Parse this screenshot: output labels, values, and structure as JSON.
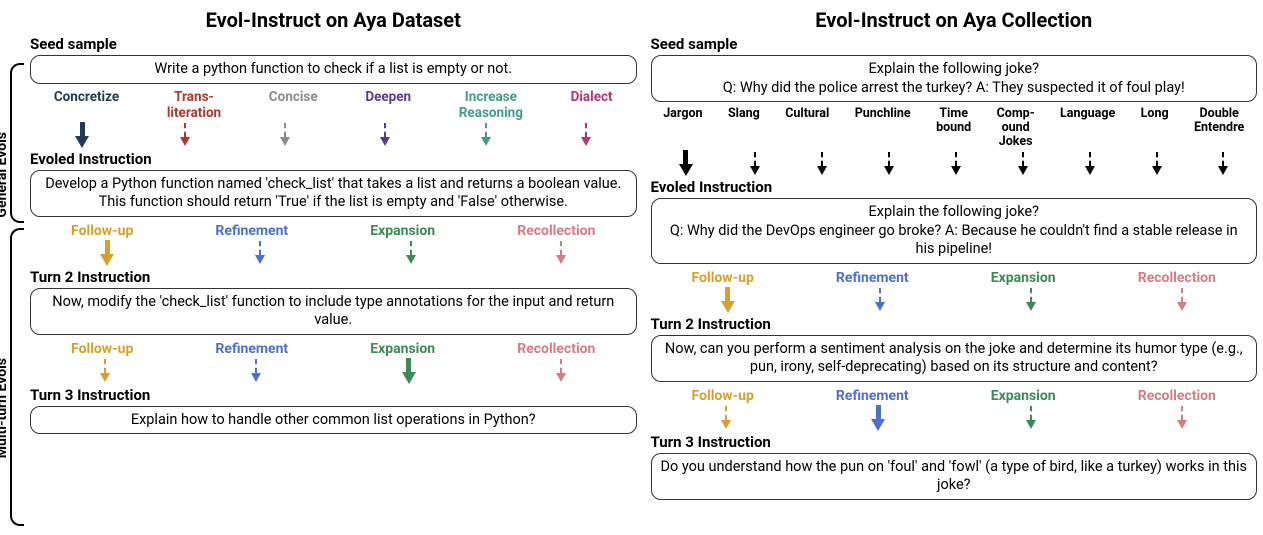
{
  "left": {
    "title": "Evol-Instruct on Aya Dataset",
    "seed_head": "Seed sample",
    "seed_text": "Write a  python function to check if a list is empty or not.",
    "gen_tags": {
      "concretize": "Concretize",
      "translit": "Trans-\nliteration",
      "concise": "Concise",
      "deepen": "Deepen",
      "reason": "Increase\nReasoning",
      "dialect": "Dialect"
    },
    "evoled_head": "Evoled Instruction",
    "evoled_text": "Develop a Python function named 'check_list' that takes a list and returns a boolean value. This function should return 'True' if the list is empty and 'False' otherwise.",
    "mt": {
      "followup": "Follow-up",
      "refine": "Refinement",
      "expand": "Expansion",
      "recoll": "Recollection"
    },
    "turn2_head": "Turn 2 Instruction",
    "turn2_text": "Now, modify the 'check_list' function to include type annotations for the input and return value.",
    "turn3_head": "Turn 3 Instruction",
    "turn3_text": "Explain how to handle other common list operations in Python?"
  },
  "right": {
    "title": "Evol-Instruct on Aya Collection",
    "seed_head": "Seed sample",
    "seed_text_l1": "Explain the following joke?",
    "seed_text_l2": "Q: Why did the police arrest the turkey? A: They suspected it of foul play!",
    "gen_tags": {
      "jargon": "Jargon",
      "slang": "Slang",
      "cultural": "Cultural",
      "punchline": "Punchline",
      "time": "Time\nbound",
      "compound": "Comp-\nound\nJokes",
      "language": "Language",
      "long": "Long",
      "double": "Double\nEntendre"
    },
    "evoled_head": "Evoled Instruction",
    "evoled_text_l1": "Explain the following joke?",
    "evoled_text_l2": "Q: Why did the DevOps engineer go broke? A: Because he couldn't find a stable release in his pipeline!",
    "mt": {
      "followup": "Follow-up",
      "refine": "Refinement",
      "expand": "Expansion",
      "recoll": "Recollection"
    },
    "turn2_head": "Turn 2 Instruction",
    "turn2_text": "Now, can you perform a sentiment analysis on the joke and determine its humor type (e.g., pun, irony, self-deprecating) based on its structure and content?",
    "turn3_head": "Turn 3 Instruction",
    "turn3_text": "Do you understand how the pun on 'foul' and 'fowl' (a type of bird, like a turkey) works in this joke?"
  },
  "side": {
    "general": "General Evols",
    "multi": "Multi-turn Evols"
  }
}
